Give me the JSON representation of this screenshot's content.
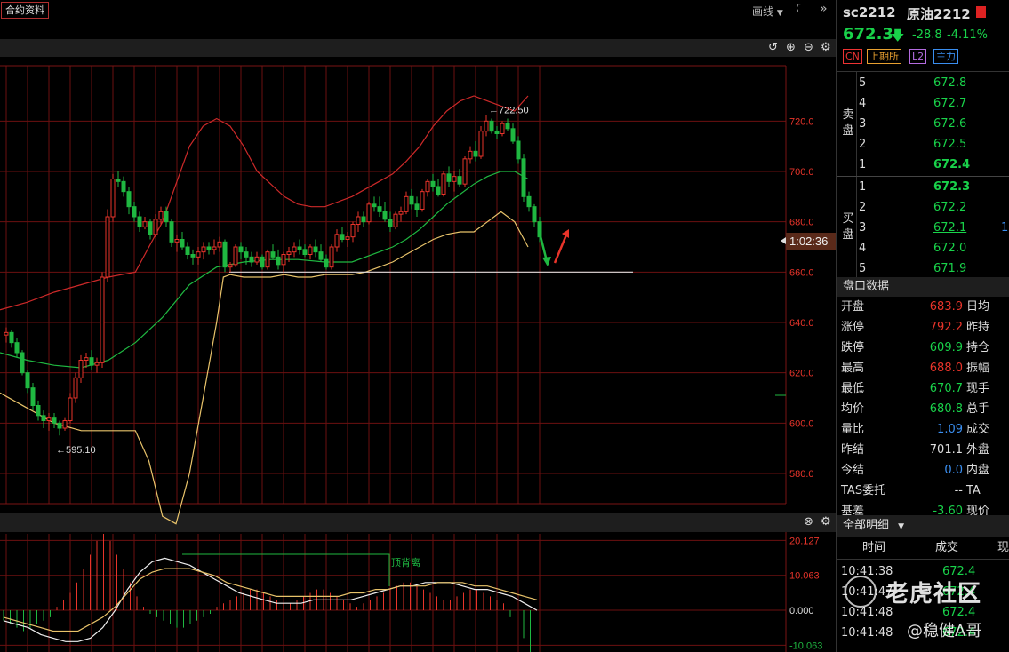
{
  "top": {
    "tab_contract": "合约资料",
    "draw_label": "画线",
    "draw_caret": "▼",
    "fullscreen_icon": "⛶",
    "expand_icon": "»"
  },
  "chart_data": [
    {
      "type": "candlestick",
      "ylim": [
        568,
        742
      ],
      "y_ticks": [
        "720.0",
        "700.0",
        "680.0",
        "660.0",
        "640.0",
        "620.0",
        "600.0",
        "580.0"
      ],
      "high_marker": "722.50",
      "low_marker": "595.10",
      "countdown": "1:02:36",
      "horizontal_line": 660,
      "colors": {
        "up": "#e8342a",
        "down": "#1fb841",
        "upper_band": "#cc2929",
        "mid_band": "#1fb841",
        "lower_band": "#e8c36a",
        "grid": "#6b1010"
      },
      "candles_ohlc": [
        [
          635,
          638,
          632,
          636
        ],
        [
          636,
          637,
          630,
          632
        ],
        [
          632,
          634,
          626,
          628
        ],
        [
          628,
          629,
          619,
          620
        ],
        [
          620,
          621,
          612,
          614
        ],
        [
          614,
          616,
          605,
          607
        ],
        [
          607,
          609,
          601,
          603
        ],
        [
          603,
          605,
          598,
          601
        ],
        [
          601,
          604,
          597,
          602
        ],
        [
          602,
          604,
          598,
          600
        ],
        [
          600,
          601,
          595.1,
          598
        ],
        [
          598,
          602,
          597,
          601
        ],
        [
          601,
          612,
          600,
          610
        ],
        [
          610,
          620,
          608,
          618
        ],
        [
          618,
          627,
          616,
          625
        ],
        [
          625,
          628,
          622,
          626
        ],
        [
          626,
          629,
          621,
          623
        ],
        [
          623,
          626,
          620,
          624
        ],
        [
          624,
          660,
          622,
          658
        ],
        [
          658,
          685,
          656,
          682
        ],
        [
          682,
          699,
          680,
          697
        ],
        [
          697,
          700,
          694,
          696
        ],
        [
          696,
          698,
          690,
          692
        ],
        [
          692,
          694,
          683,
          686
        ],
        [
          686,
          688,
          680,
          682
        ],
        [
          682,
          684,
          676,
          678
        ],
        [
          678,
          682,
          677,
          680
        ],
        [
          680,
          681,
          673,
          675
        ],
        [
          675,
          683,
          674,
          681
        ],
        [
          681,
          686,
          679,
          684
        ],
        [
          684,
          686,
          678,
          680
        ],
        [
          680,
          681,
          670,
          672
        ],
        [
          672,
          675,
          668,
          673
        ],
        [
          673,
          676,
          669,
          670
        ],
        [
          670,
          672,
          665,
          667
        ],
        [
          667,
          669,
          663,
          666
        ],
        [
          666,
          670,
          663,
          668
        ],
        [
          668,
          672,
          665,
          670
        ],
        [
          670,
          672,
          667,
          669
        ],
        [
          669,
          673,
          667,
          670
        ],
        [
          670,
          674,
          668,
          672
        ],
        [
          672,
          673,
          660,
          662
        ],
        [
          662,
          664,
          660,
          663
        ],
        [
          663,
          671,
          662,
          670
        ],
        [
          670,
          672,
          665,
          668
        ],
        [
          668,
          670,
          663,
          666
        ],
        [
          666,
          668,
          662,
          664
        ],
        [
          664,
          668,
          663,
          666
        ],
        [
          666,
          667,
          661,
          662
        ],
        [
          662,
          669,
          661,
          668
        ],
        [
          668,
          671,
          665,
          666
        ],
        [
          666,
          669,
          661,
          663
        ],
        [
          663,
          668,
          660,
          667
        ],
        [
          667,
          670,
          664,
          668
        ],
        [
          668,
          672,
          666,
          670
        ],
        [
          670,
          673,
          667,
          669
        ],
        [
          669,
          671,
          666,
          667
        ],
        [
          667,
          671,
          665,
          670
        ],
        [
          670,
          673,
          666,
          668
        ],
        [
          668,
          671,
          664,
          665
        ],
        [
          665,
          667,
          661,
          662
        ],
        [
          662,
          671,
          661,
          670
        ],
        [
          670,
          677,
          668,
          675
        ],
        [
          675,
          678,
          672,
          673
        ],
        [
          673,
          676,
          670,
          674
        ],
        [
          674,
          680,
          672,
          679
        ],
        [
          679,
          684,
          676,
          682
        ],
        [
          682,
          684,
          678,
          680
        ],
        [
          680,
          688,
          679,
          687
        ],
        [
          687,
          690,
          684,
          686
        ],
        [
          686,
          690,
          682,
          684
        ],
        [
          684,
          688,
          680,
          681
        ],
        [
          681,
          684,
          676,
          678
        ],
        [
          678,
          684,
          677,
          683
        ],
        [
          683,
          686,
          680,
          684
        ],
        [
          684,
          692,
          683,
          690
        ],
        [
          690,
          693,
          685,
          687
        ],
        [
          687,
          690,
          682,
          685
        ],
        [
          685,
          693,
          684,
          692
        ],
        [
          692,
          697,
          690,
          696
        ],
        [
          696,
          699,
          692,
          694
        ],
        [
          694,
          697,
          690,
          691
        ],
        [
          691,
          700,
          690,
          699
        ],
        [
          699,
          702,
          694,
          696
        ],
        [
          696,
          700,
          692,
          698
        ],
        [
          698,
          701,
          694,
          695
        ],
        [
          695,
          706,
          694,
          705
        ],
        [
          705,
          710,
          703,
          708
        ],
        [
          708,
          712,
          704,
          706
        ],
        [
          706,
          718,
          705,
          716
        ],
        [
          716,
          722.5,
          714,
          720
        ],
        [
          720,
          721,
          715,
          716
        ],
        [
          716,
          718,
          713,
          715
        ],
        [
          715,
          720,
          714,
          719
        ],
        [
          719,
          721,
          716,
          717
        ],
        [
          717,
          719,
          711,
          712
        ],
        [
          712,
          714,
          703,
          705
        ],
        [
          705,
          707,
          688,
          690
        ],
        [
          690,
          692,
          684,
          686
        ],
        [
          686,
          687,
          678,
          680
        ],
        [
          680,
          682,
          672,
          674
        ]
      ],
      "upper_band": [
        [
          0,
          645
        ],
        [
          20,
          648
        ],
        [
          40,
          652
        ],
        [
          60,
          655
        ],
        [
          80,
          658
        ],
        [
          100,
          660
        ],
        [
          120,
          680
        ],
        [
          140,
          710
        ],
        [
          150,
          718
        ],
        [
          160,
          721
        ],
        [
          170,
          718
        ],
        [
          180,
          710
        ],
        [
          190,
          700
        ],
        [
          200,
          695
        ],
        [
          210,
          690
        ],
        [
          220,
          687
        ],
        [
          230,
          686
        ],
        [
          240,
          686
        ],
        [
          250,
          688
        ],
        [
          260,
          690
        ],
        [
          270,
          693
        ],
        [
          280,
          696
        ],
        [
          290,
          699
        ],
        [
          300,
          704
        ],
        [
          310,
          710
        ],
        [
          320,
          718
        ],
        [
          330,
          724
        ],
        [
          340,
          728
        ],
        [
          350,
          730
        ],
        [
          360,
          728
        ],
        [
          370,
          726
        ],
        [
          380,
          724
        ],
        [
          390,
          730
        ]
      ],
      "mid_band": [
        [
          0,
          628
        ],
        [
          20,
          625
        ],
        [
          40,
          623
        ],
        [
          60,
          622
        ],
        [
          80,
          625
        ],
        [
          100,
          632
        ],
        [
          120,
          642
        ],
        [
          140,
          655
        ],
        [
          160,
          662
        ],
        [
          180,
          664
        ],
        [
          200,
          665
        ],
        [
          220,
          665
        ],
        [
          240,
          664
        ],
        [
          260,
          664
        ],
        [
          280,
          668
        ],
        [
          290,
          670
        ],
        [
          300,
          673
        ],
        [
          310,
          677
        ],
        [
          320,
          682
        ],
        [
          330,
          687
        ],
        [
          340,
          691
        ],
        [
          350,
          695
        ],
        [
          360,
          698
        ],
        [
          370,
          700
        ],
        [
          380,
          700
        ],
        [
          390,
          697
        ]
      ],
      "lower_band": [
        [
          0,
          612
        ],
        [
          20,
          606
        ],
        [
          40,
          600
        ],
        [
          60,
          597
        ],
        [
          80,
          597
        ],
        [
          100,
          597
        ],
        [
          110,
          585
        ],
        [
          120,
          563
        ],
        [
          130,
          560
        ],
        [
          140,
          580
        ],
        [
          150,
          610
        ],
        [
          160,
          640
        ],
        [
          165,
          658
        ],
        [
          170,
          659
        ],
        [
          180,
          658
        ],
        [
          190,
          658
        ],
        [
          200,
          658
        ],
        [
          210,
          659
        ],
        [
          220,
          658
        ],
        [
          230,
          658
        ],
        [
          240,
          659
        ],
        [
          250,
          659
        ],
        [
          260,
          659
        ],
        [
          270,
          660
        ],
        [
          280,
          662
        ],
        [
          290,
          664
        ],
        [
          300,
          667
        ],
        [
          310,
          670
        ],
        [
          320,
          673
        ],
        [
          330,
          675
        ],
        [
          340,
          676
        ],
        [
          350,
          676
        ],
        [
          360,
          680
        ],
        [
          370,
          684
        ],
        [
          380,
          680
        ],
        [
          390,
          670
        ]
      ],
      "xlim": [
        0,
        390
      ]
    },
    {
      "type": "macd",
      "ylim": [
        -12,
        22
      ],
      "y_ticks": [
        "20.127",
        "10.063",
        "0.000",
        "-10.063"
      ],
      "annotation": "顶背离",
      "histogram": [
        -3,
        -4,
        -5,
        -6,
        -5,
        -4,
        -3,
        -2,
        1,
        3,
        5,
        8,
        12,
        16,
        20,
        22,
        20,
        16,
        12,
        8,
        4,
        1,
        -1,
        -2,
        -3,
        -4,
        -5,
        -5,
        -4,
        -3,
        -2,
        -1,
        1,
        2,
        3,
        4,
        5,
        6,
        6,
        5,
        4,
        3,
        2,
        2,
        3,
        4,
        5,
        6,
        6,
        5,
        4,
        3,
        2,
        1,
        2,
        3,
        4,
        5,
        6,
        7,
        8,
        8,
        7,
        6,
        5,
        4,
        3,
        3,
        4,
        5,
        6,
        6,
        5,
        4,
        3,
        2,
        -2,
        -5,
        -8,
        -12
      ],
      "dif": [
        -3,
        -4,
        -5,
        -7,
        -8,
        -9,
        -9,
        -8,
        -5,
        0,
        6,
        11,
        14,
        15,
        14,
        13,
        11,
        9,
        7,
        5,
        4,
        3,
        2,
        2,
        2,
        3,
        3,
        3,
        3,
        4,
        5,
        6,
        7,
        7,
        8,
        8,
        8,
        7,
        6,
        6,
        5,
        4,
        2,
        0
      ],
      "dea": [
        -2,
        -3,
        -4,
        -5,
        -6,
        -6,
        -6,
        -4,
        -2,
        1,
        5,
        9,
        11,
        12,
        12,
        12,
        11,
        10,
        8,
        7,
        6,
        5,
        4,
        4,
        4,
        4,
        4,
        4,
        5,
        5,
        6,
        6,
        7,
        7,
        7,
        8,
        8,
        8,
        7,
        7,
        6,
        5,
        4,
        3
      ]
    }
  ],
  "toolbar_icons": [
    "undo-icon",
    "zoom-in-icon",
    "zoom-out-icon",
    "settings-icon"
  ],
  "panel": {
    "symbol": "sc2212",
    "name": "原油2212",
    "flag": "!",
    "price": "672.3",
    "arrow": "🡇",
    "change": "-28.8",
    "pct": "-4.11%",
    "tags": [
      {
        "label": "CN",
        "color": "#e33"
      },
      {
        "label": "上期所",
        "color": "#e8a030"
      },
      {
        "label": "L2",
        "color": "#b46ce0"
      },
      {
        "label": "主力",
        "color": "#3a8ef0"
      }
    ],
    "sell_label": "卖盘",
    "buy_label": "买盘",
    "asks": [
      {
        "level": "5",
        "price": "672.8"
      },
      {
        "level": "4",
        "price": "672.7"
      },
      {
        "level": "3",
        "price": "672.6"
      },
      {
        "level": "2",
        "price": "672.5"
      },
      {
        "level": "1",
        "price": "672.4"
      }
    ],
    "bids": [
      {
        "level": "1",
        "price": "672.3",
        "extra": ""
      },
      {
        "level": "2",
        "price": "672.2",
        "extra": ""
      },
      {
        "level": "3",
        "price": "672.1",
        "extra": "1"
      },
      {
        "level": "4",
        "price": "672.0",
        "extra": ""
      },
      {
        "level": "5",
        "price": "671.9",
        "extra": ""
      }
    ],
    "market_header": "盘口数据",
    "market": [
      {
        "k": "开盘",
        "v": "683.9",
        "c": "#e8342a",
        "k2": "日均"
      },
      {
        "k": "涨停",
        "v": "792.2",
        "c": "#e8342a",
        "k2": "昨持"
      },
      {
        "k": "跌停",
        "v": "609.9",
        "c": "#19d24a",
        "k2": "持仓"
      },
      {
        "k": "最高",
        "v": "688.0",
        "c": "#e8342a",
        "k2": "振幅"
      },
      {
        "k": "最低",
        "v": "670.7",
        "c": "#19d24a",
        "k2": "现手"
      },
      {
        "k": "均价",
        "v": "680.8",
        "c": "#19d24a",
        "k2": "总手"
      },
      {
        "k": "量比",
        "v": "1.09",
        "c": "#3a8ef0",
        "k2": "成交"
      },
      {
        "k": "昨结",
        "v": "701.1",
        "c": "#ddd",
        "k2": "外盘"
      },
      {
        "k": "今结",
        "v": "0.0",
        "c": "#3a8ef0",
        "k2": "内盘"
      },
      {
        "k": "TAS委托",
        "v": "--",
        "c": "#ddd",
        "k2": "TA"
      },
      {
        "k": "基差",
        "v": "-3.60",
        "c": "#19d24a",
        "k2": "现价"
      }
    ],
    "detail_header": "全部明细",
    "detail_caret": "▼",
    "detail_cols": {
      "time": "时间",
      "deal": "成交",
      "now": "现"
    },
    "details": [
      {
        "t": "10:41:38",
        "p": "672.4"
      },
      {
        "t": "10:41:47",
        "p": "672.4"
      },
      {
        "t": "10:41:48",
        "p": "672.4"
      },
      {
        "t": "10:41:48",
        "p": "672.4"
      }
    ]
  },
  "watermark": {
    "title": "老虎社区",
    "user": "@稳健A哥"
  }
}
